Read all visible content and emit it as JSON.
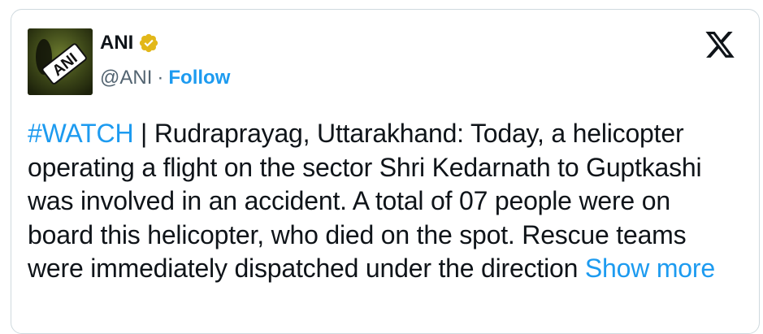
{
  "account": {
    "display_name": "ANI",
    "handle": "@ANI",
    "separator": "·",
    "follow_label": "Follow",
    "avatar_text": "ANI",
    "verified_color": "#e2b719"
  },
  "tweet": {
    "hashtag": "#WATCH",
    "text_after_hashtag": " | Rudraprayag, Uttarakhand: Today, a helicopter operating a flight on the sector Shri Kedarnath to Guptkashi was involved in an accident. A total of 07 people were on board this helicopter, who died on the spot. Rescue teams were immediately dispatched under the direction ",
    "show_more_label": "Show more"
  },
  "colors": {
    "link": "#1d9bf0",
    "text": "#0f1419",
    "muted": "#536471",
    "border": "#cfd9de"
  },
  "icons": {
    "verified": "verified-badge-icon",
    "platform": "x-logo-icon"
  }
}
